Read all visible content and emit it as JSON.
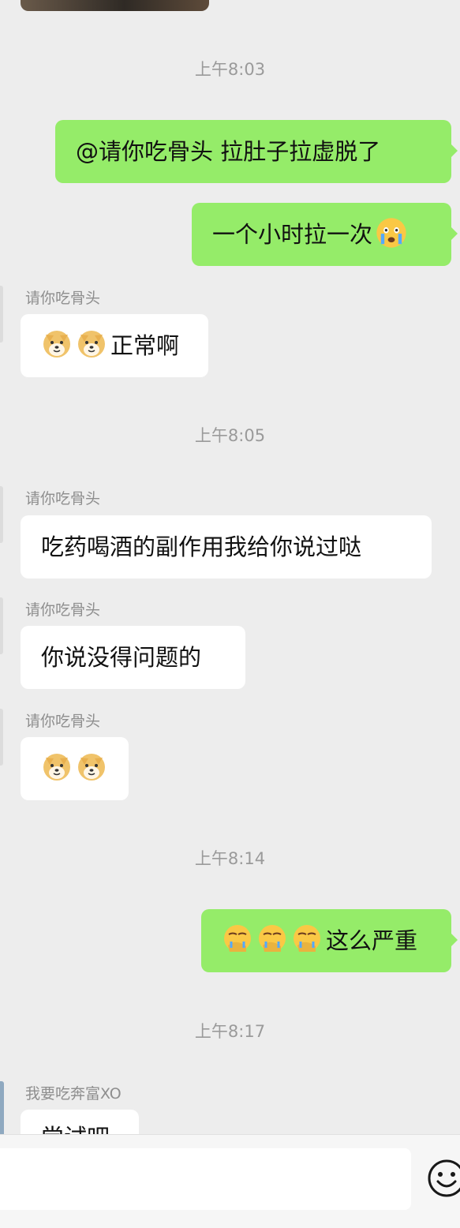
{
  "messages": {
    "t1": "上午8:03",
    "m1": "@请你吃骨头  拉肚子拉虚脱了",
    "m2": "一个小时拉一次",
    "name": "请你吃骨头",
    "m3": "正常啊",
    "t2": "上午8:05",
    "m4": "吃药喝酒的副作用我给你说过哒",
    "m5": "你说没得问题的",
    "t3": "上午8:14",
    "m7": "这么严重",
    "t4": "上午8:17",
    "name2": "我要吃奔富XO",
    "m8": "尝试吧"
  },
  "icons": {
    "crying": "crying-face-emoji",
    "doge": "doge-emoji",
    "facepalm": "facepalm-emoji",
    "smile": "smile-icon"
  },
  "colors": {
    "background": "#ededed",
    "outgoing_bubble": "#95ec69",
    "incoming_bubble": "#ffffff"
  }
}
